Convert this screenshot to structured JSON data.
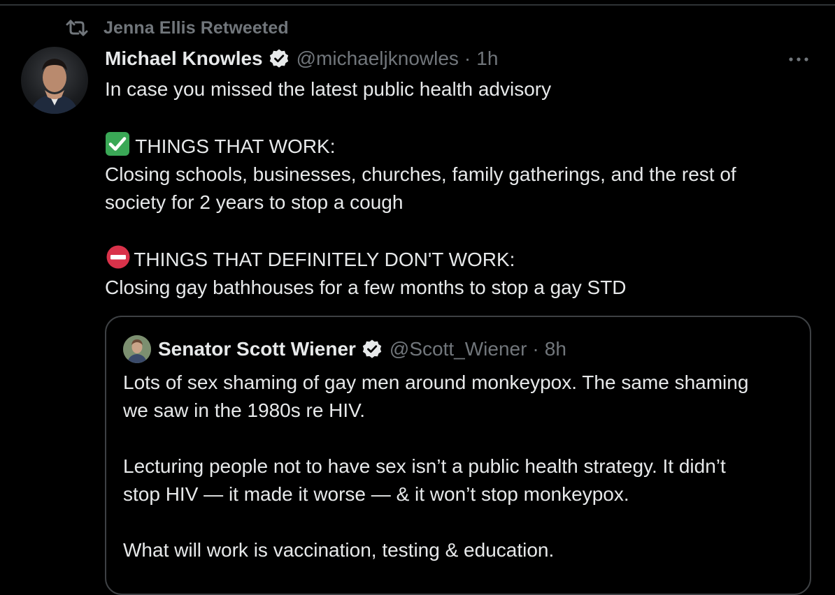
{
  "retweet": {
    "icon": "retweet-icon",
    "text": "Jenna Ellis Retweeted"
  },
  "tweet": {
    "author_name": "Michael Knowles",
    "verified": true,
    "handle": "@michaeljknowles",
    "separator": "·",
    "time": "1h",
    "more_icon": "more-horizontal-icon",
    "lines": {
      "intro": "In case you missed the latest public health advisory",
      "works_heading": "THINGS THAT WORK:",
      "works_line1": "Closing schools, businesses, churches, family gatherings, and the rest of",
      "works_line2": "society for 2 years to stop a cough",
      "dont_heading": "THINGS THAT DEFINITELY DON'T WORK:",
      "dont_line1": "Closing gay bathhouses for a few months to stop a gay STD"
    },
    "emoji": {
      "check": "check-mark-emoji",
      "no_entry": "no-entry-emoji"
    }
  },
  "quote": {
    "author_name": "Senator Scott Wiener",
    "verified": true,
    "handle": "@Scott_Wiener",
    "separator": "·",
    "time": "8h",
    "lines": {
      "p1_l1": "Lots of sex shaming of gay men around monkeypox. The same shaming",
      "p1_l2": "we saw in the 1980s re HIV.",
      "p2_l1": "Lecturing people not to have sex isn’t a public health strategy. It didn’t",
      "p2_l2": "stop HIV — it made it worse — & it won’t stop monkeypox.",
      "p3_l1": "What will work is vaccination, testing & education."
    }
  },
  "colors": {
    "background": "#000000",
    "text_primary": "#e7e9ea",
    "text_secondary": "#71767b",
    "border": "#3e4144",
    "check_green": "#3aa856",
    "no_entry_red": "#d9324a"
  }
}
